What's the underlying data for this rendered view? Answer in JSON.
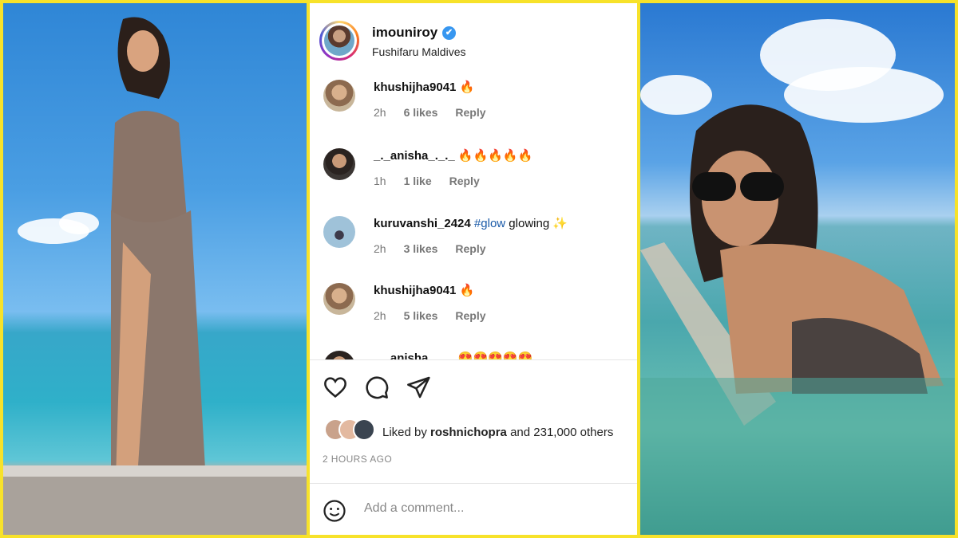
{
  "post": {
    "username": "imouniroy",
    "verified_badge": "✔",
    "location": "Fushifaru Maldives"
  },
  "comments": [
    {
      "user": "khushijha9041",
      "text": "🔥",
      "time": "2h",
      "likes": "6 likes",
      "reply": "Reply"
    },
    {
      "user": "_._anisha_._._",
      "text": "🔥🔥🔥🔥🔥",
      "time": "1h",
      "likes": "1 like",
      "reply": "Reply"
    },
    {
      "user": "kuruvanshi_2424",
      "tag": "#glow",
      "text": "glowing ✨",
      "time": "2h",
      "likes": "3 likes",
      "reply": "Reply"
    },
    {
      "user": "khushijha9041",
      "text": "🔥",
      "time": "2h",
      "likes": "5 likes",
      "reply": "Reply"
    },
    {
      "user": "_._anisha_._._",
      "text": "😍😍😍😍😍"
    }
  ],
  "actions": {
    "like": "heart-icon",
    "comment": "comment-icon",
    "share": "send-icon"
  },
  "liked_by": {
    "prefix": "Liked by",
    "user": "roshnichopra",
    "suffix": "and 231,000 others"
  },
  "timestamp": "2 HOURS AGO",
  "add_comment": {
    "placeholder": "Add a comment..."
  },
  "colors": {
    "background": "#f7e22a",
    "link": "#1a5aa8",
    "verified": "#3897f0"
  }
}
